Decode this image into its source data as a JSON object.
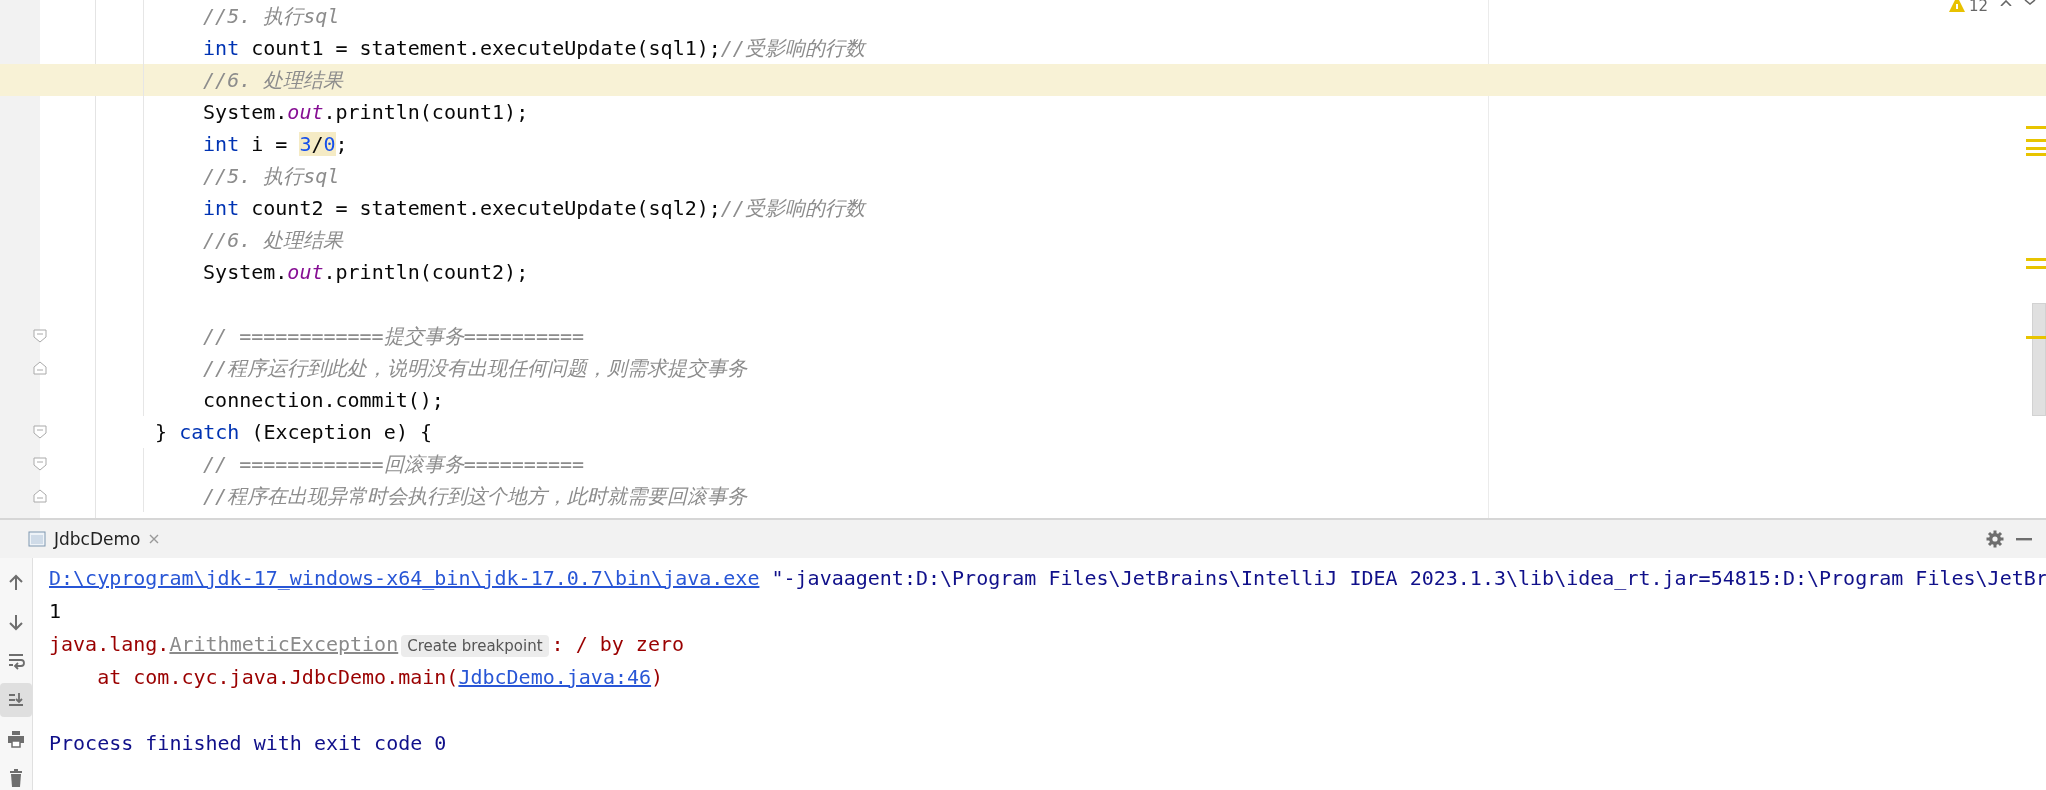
{
  "editor": {
    "warning_count": "12",
    "blocks": [
      {
        "children": [
          {
            "current": false,
            "tokens": [
              {
                "kind": "comment",
                "text": "//5. 执行sql"
              }
            ]
          },
          {
            "current": false,
            "tokens": [
              {
                "kind": "keyword",
                "text": "int"
              },
              {
                "kind": "plain",
                "text": " count1 = statement.executeUpdate(sql1);"
              },
              {
                "kind": "comment",
                "text": "//受影响的行数"
              }
            ]
          },
          {
            "current": true,
            "tokens": [
              {
                "kind": "comment",
                "text": "//6. 处理结果"
              }
            ]
          },
          {
            "current": false,
            "tokens": [
              {
                "kind": "plain",
                "text": "System."
              },
              {
                "kind": "field",
                "text": "out"
              },
              {
                "kind": "plain",
                "text": ".println(count1);"
              }
            ]
          },
          {
            "current": false,
            "tokens": [
              {
                "kind": "keyword",
                "text": "int"
              },
              {
                "kind": "plain",
                "text": " i = "
              },
              {
                "kind": "match",
                "parts": [
                  {
                    "kind": "number",
                    "text": "3"
                  },
                  {
                    "kind": "plain",
                    "text": "/"
                  },
                  {
                    "kind": "number",
                    "text": "0"
                  }
                ]
              },
              {
                "kind": "plain",
                "text": ";"
              }
            ]
          },
          {
            "current": false,
            "tokens": [
              {
                "kind": "comment",
                "text": "//5. 执行sql"
              }
            ]
          },
          {
            "current": false,
            "tokens": [
              {
                "kind": "keyword",
                "text": "int"
              },
              {
                "kind": "plain",
                "text": " count2 = statement.executeUpdate(sql2);"
              },
              {
                "kind": "comment",
                "text": "//受影响的行数"
              }
            ]
          },
          {
            "current": false,
            "tokens": [
              {
                "kind": "comment",
                "text": "//6. 处理结果"
              }
            ]
          },
          {
            "current": false,
            "tokens": [
              {
                "kind": "plain",
                "text": "System."
              },
              {
                "kind": "field",
                "text": "out"
              },
              {
                "kind": "plain",
                "text": ".println(count2);"
              }
            ]
          },
          {
            "current": false
          },
          {
            "current": false,
            "kind": "opener",
            "tokens": [
              {
                "kind": "comment",
                "text": "// ============提交事务=========="
              }
            ]
          },
          {
            "current": false,
            "kind": "closer",
            "tokens": [
              {
                "kind": "comment",
                "text": "//程序运行到此处，说明没有出现任何问题，则需求提交事务"
              }
            ]
          },
          {
            "current": false,
            "tokens": [
              {
                "kind": "plain",
                "text": "connection.commit();"
              }
            ]
          }
        ]
      },
      {
        "current": false,
        "kind": "opener",
        "tokens": [
          {
            "kind": "plain",
            "text": "} "
          },
          {
            "kind": "keyword",
            "text": "catch"
          },
          {
            "kind": "plain",
            "text": " (Exception e) {"
          }
        ],
        "children": [
          {
            "current": false,
            "kind": "opener",
            "tokens": [
              {
                "kind": "comment",
                "text": "// ============回滚事务=========="
              }
            ]
          },
          {
            "current": false,
            "kind": "closer",
            "tokens": [
              {
                "kind": "comment",
                "text": "//程序在出现异常时会执行到这个地方，此时就需要回滚事务"
              }
            ]
          }
        ]
      }
    ]
  },
  "run_panel": {
    "tabs": [
      {
        "label": "JdbcDemo",
        "selected": true
      }
    ],
    "toolbar": [
      {
        "kind": "up",
        "selected": false
      },
      {
        "kind": "down",
        "selected": false
      },
      {
        "kind": "wrap",
        "selected": false
      },
      {
        "kind": "scroll-end",
        "selected": true
      },
      {
        "kind": "print",
        "selected": false
      },
      {
        "kind": "trash",
        "selected": false
      }
    ],
    "console": {
      "lines": [
        [
          {
            "kind": "link",
            "text": "D:\\cyprogram\\jdk-17_windows-x64_bin\\jdk-17.0.7\\bin\\java.exe"
          },
          {
            "kind": "command",
            "text": " \"-javaagent:D:\\Program Files\\JetBrains\\IntelliJ IDEA 2023.1.3\\lib\\idea_rt.jar=54815:D:\\Program Files\\JetBr"
          }
        ],
        [
          {
            "kind": "output",
            "text": "1"
          }
        ],
        [
          {
            "kind": "error",
            "text": "java.lang."
          },
          {
            "kind": "exception",
            "text": "ArithmeticException"
          },
          {
            "kind": "hint",
            "text": "Create breakpoint"
          },
          {
            "kind": "error",
            "text": ": / by zero"
          }
        ],
        [
          {
            "kind": "error",
            "text": "    at com.cyc.java.JdbcDemo.main("
          },
          {
            "kind": "link",
            "text": "JdbcDemo.java:46"
          },
          {
            "kind": "error",
            "text": ")"
          }
        ]
      ],
      "exit_message": "Process finished with exit code 0"
    }
  }
}
